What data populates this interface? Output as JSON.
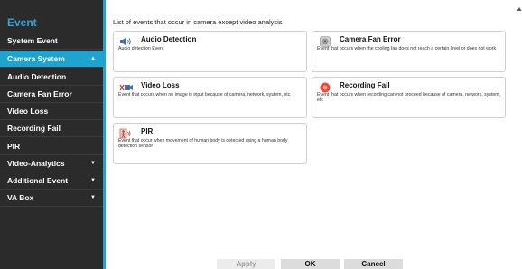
{
  "sidebar": {
    "title": "Event",
    "items": [
      {
        "label": "System Event",
        "arrow": ""
      },
      {
        "label": "Camera System",
        "arrow": "▲"
      },
      {
        "label": "Audio Detection",
        "arrow": ""
      },
      {
        "label": "Camera Fan Error",
        "arrow": ""
      },
      {
        "label": "Video Loss",
        "arrow": ""
      },
      {
        "label": "Recording Fail",
        "arrow": ""
      },
      {
        "label": "PIR",
        "arrow": ""
      },
      {
        "label": "Video-Analytics",
        "arrow": "▼"
      },
      {
        "label": "Additional Event",
        "arrow": "▼"
      },
      {
        "label": "VA Box",
        "arrow": "▼"
      }
    ]
  },
  "main": {
    "title": "List of events that occur in camera except video analysis",
    "cards": [
      {
        "name": "Audio Detection",
        "desc": "Audio detection Event",
        "icon": "speaker-icon"
      },
      {
        "name": "Camera Fan Error",
        "desc": "Event that occurs when the cooling fan does not reach a certain level or does not work",
        "icon": "fan-icon"
      },
      {
        "name": "Video Loss",
        "desc": "Event that occurs when no image is input because of camera, network, system, etc",
        "icon": "video-loss-icon"
      },
      {
        "name": "Recording Fail",
        "desc": "Event that occurs when recording can not proceed because of camera, network, system, etc",
        "icon": "recording-fail-icon"
      },
      {
        "name": "PIR",
        "desc": "Event that occur when movement of human body is detected using a human body detection sensor",
        "icon": "pir-icon"
      }
    ]
  },
  "footer": {
    "apply": "Apply",
    "ok": "OK",
    "cancel": "Cancel"
  },
  "colors": {
    "accent": "#1fa3cf",
    "sidebar_bg": "#2b2b2b"
  }
}
